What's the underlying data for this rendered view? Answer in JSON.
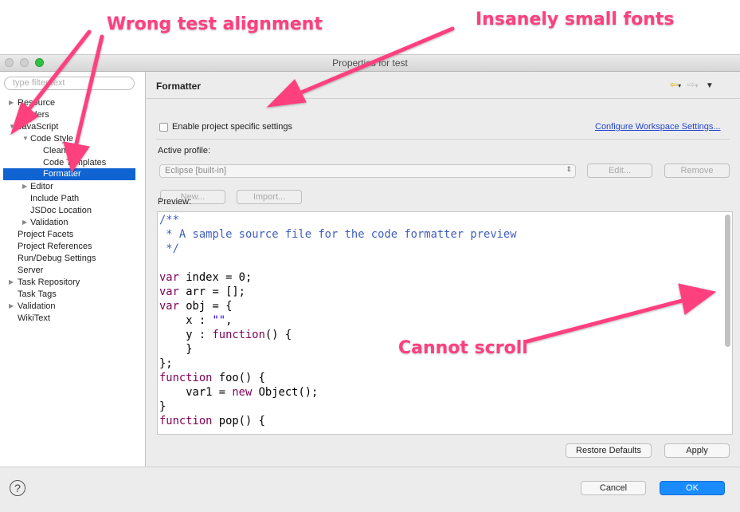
{
  "annotations": {
    "wrong_alignment": "Wrong test alignment",
    "small_fonts": "Insanely small fonts",
    "cannot_scroll": "Cannot scroll"
  },
  "window": {
    "title": "Properties for test"
  },
  "sidebar": {
    "filter_placeholder": "type filter text",
    "items": [
      {
        "label": "Resource",
        "twisty": "▶"
      },
      {
        "label": "Builders",
        "twisty": ""
      },
      {
        "label": "JavaScript",
        "twisty": "▼"
      },
      {
        "label": "Code Style",
        "twisty": "▼"
      },
      {
        "label": "Clean Up",
        "twisty": ""
      },
      {
        "label": "Code Templates",
        "twisty": ""
      },
      {
        "label": "Formatter",
        "twisty": "",
        "selected": true
      },
      {
        "label": "Editor",
        "twisty": "▶"
      },
      {
        "label": "Include Path",
        "twisty": ""
      },
      {
        "label": "JSDoc Location",
        "twisty": ""
      },
      {
        "label": "Validation",
        "twisty": "▶"
      },
      {
        "label": "Project Facets",
        "twisty": ""
      },
      {
        "label": "Project References",
        "twisty": ""
      },
      {
        "label": "Run/Debug Settings",
        "twisty": ""
      },
      {
        "label": "Server",
        "twisty": ""
      },
      {
        "label": "Task Repository",
        "twisty": "▶"
      },
      {
        "label": "Task Tags",
        "twisty": ""
      },
      {
        "label": "Validation",
        "twisty": "▶"
      },
      {
        "label": "WikiText",
        "twisty": ""
      }
    ]
  },
  "main": {
    "section_title": "Formatter",
    "enable_specific_label": "Enable project specific settings",
    "configure_link": "Configure Workspace Settings...",
    "active_profile_label": "Active profile:",
    "profile_value": "Eclipse [built-in]",
    "edit_button": "Edit...",
    "remove_button": "Remove",
    "new_button": "New...",
    "import_button": "Import...",
    "preview_label": "Preview:",
    "restore_defaults_button": "Restore Defaults",
    "apply_button": "Apply"
  },
  "footer": {
    "help_icon": "?",
    "cancel_button": "Cancel",
    "ok_button": "OK"
  },
  "colors": {
    "annotation": "#ff3f7f",
    "selection": "#0f64d2",
    "ok_button": "#1a8cff",
    "comment": "#3f5fbf",
    "keyword": "#7f0055",
    "string": "#2a00ff"
  }
}
